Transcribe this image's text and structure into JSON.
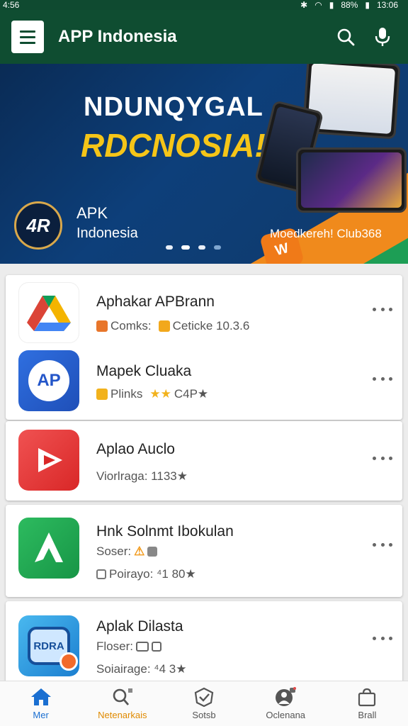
{
  "status_bar": {
    "time_left": "4:56",
    "battery": "88%",
    "time_right": "13:06"
  },
  "app_bar": {
    "title": "APP Indonesia"
  },
  "banner": {
    "headline_1": "NDUNQYGAL",
    "headline_2": "RDCNOSIA!",
    "logo_text": "4R",
    "brand_line_1": "APK",
    "brand_line_2": "Indonesia",
    "tagline": "Moedkereh! Club368",
    "badge_text": "W"
  },
  "apps": [
    {
      "name": "Aphakar APBrann",
      "meta_1": "Comks:",
      "meta_2": "Cetickе 10.3.6",
      "icon": "google-drive-style-icon",
      "icon_text": ""
    },
    {
      "name": "Mapek Cluaka",
      "meta_1": "Plinks",
      "meta_2": "C4P★",
      "icon": "ap-circle-icon",
      "icon_text": "AP"
    },
    {
      "name": "Aplao Auclo",
      "meta_1": "Viorlraga: 1133★",
      "meta_2": "",
      "icon": "play-video-icon",
      "icon_text": ""
    },
    {
      "name": "Hnk Solnmt Ibokulan",
      "meta_1": "Soser:",
      "meta_2": "Poirayo: ⁴1 80★",
      "icon": "android-a-icon",
      "icon_text": ""
    },
    {
      "name": "Aplak Dilasta",
      "meta_1": "Floser:",
      "meta_2": "Soiairage: ⁴4 3★",
      "icon": "rdra-badge-icon",
      "icon_text": "RDRA"
    }
  ],
  "bottom_nav": [
    {
      "label": "Mer",
      "icon": "home-icon"
    },
    {
      "label": "Netenarkais",
      "icon": "search-icon"
    },
    {
      "label": "Sotsb",
      "icon": "shield-check-icon"
    },
    {
      "label": "Oclenana",
      "icon": "profile-icon"
    },
    {
      "label": "Brall",
      "icon": "bag-icon"
    }
  ],
  "colors": {
    "appbar": "#0f4d31",
    "accent_yellow": "#f5c518",
    "accent_orange": "#f08a1c",
    "accent_green": "#1d9e55",
    "active_nav": "#1a6fd1"
  }
}
